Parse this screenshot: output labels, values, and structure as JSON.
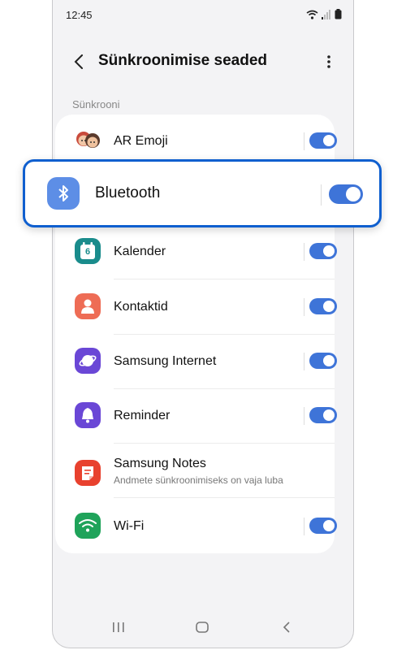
{
  "status": {
    "time": "12:45"
  },
  "header": {
    "title": "Sünkroonimise seaded"
  },
  "section": {
    "label": "Sünkrooni"
  },
  "items": [
    {
      "label": "AR Emoji",
      "icon": "ar-emoji-icon",
      "toggle": "on"
    },
    {
      "label": "Bluetooth",
      "icon": "bluetooth-icon",
      "toggle": "on"
    },
    {
      "label": "Kalender",
      "icon": "calendar-icon",
      "calendar_day": "6",
      "toggle": "on"
    },
    {
      "label": "Kontaktid",
      "icon": "contacts-icon",
      "toggle": "on"
    },
    {
      "label": "Samsung Internet",
      "icon": "samsung-internet-icon",
      "toggle": "on"
    },
    {
      "label": "Reminder",
      "icon": "reminder-icon",
      "toggle": "on"
    },
    {
      "label": "Samsung Notes",
      "sublabel": "Andmete sünkroonimiseks on vaja luba",
      "icon": "samsung-notes-icon"
    },
    {
      "label": "Wi-Fi",
      "icon": "wifi-icon",
      "toggle": "on"
    }
  ],
  "colors": {
    "accent": "#3e74d8",
    "highlight": "#0f5fcf"
  }
}
